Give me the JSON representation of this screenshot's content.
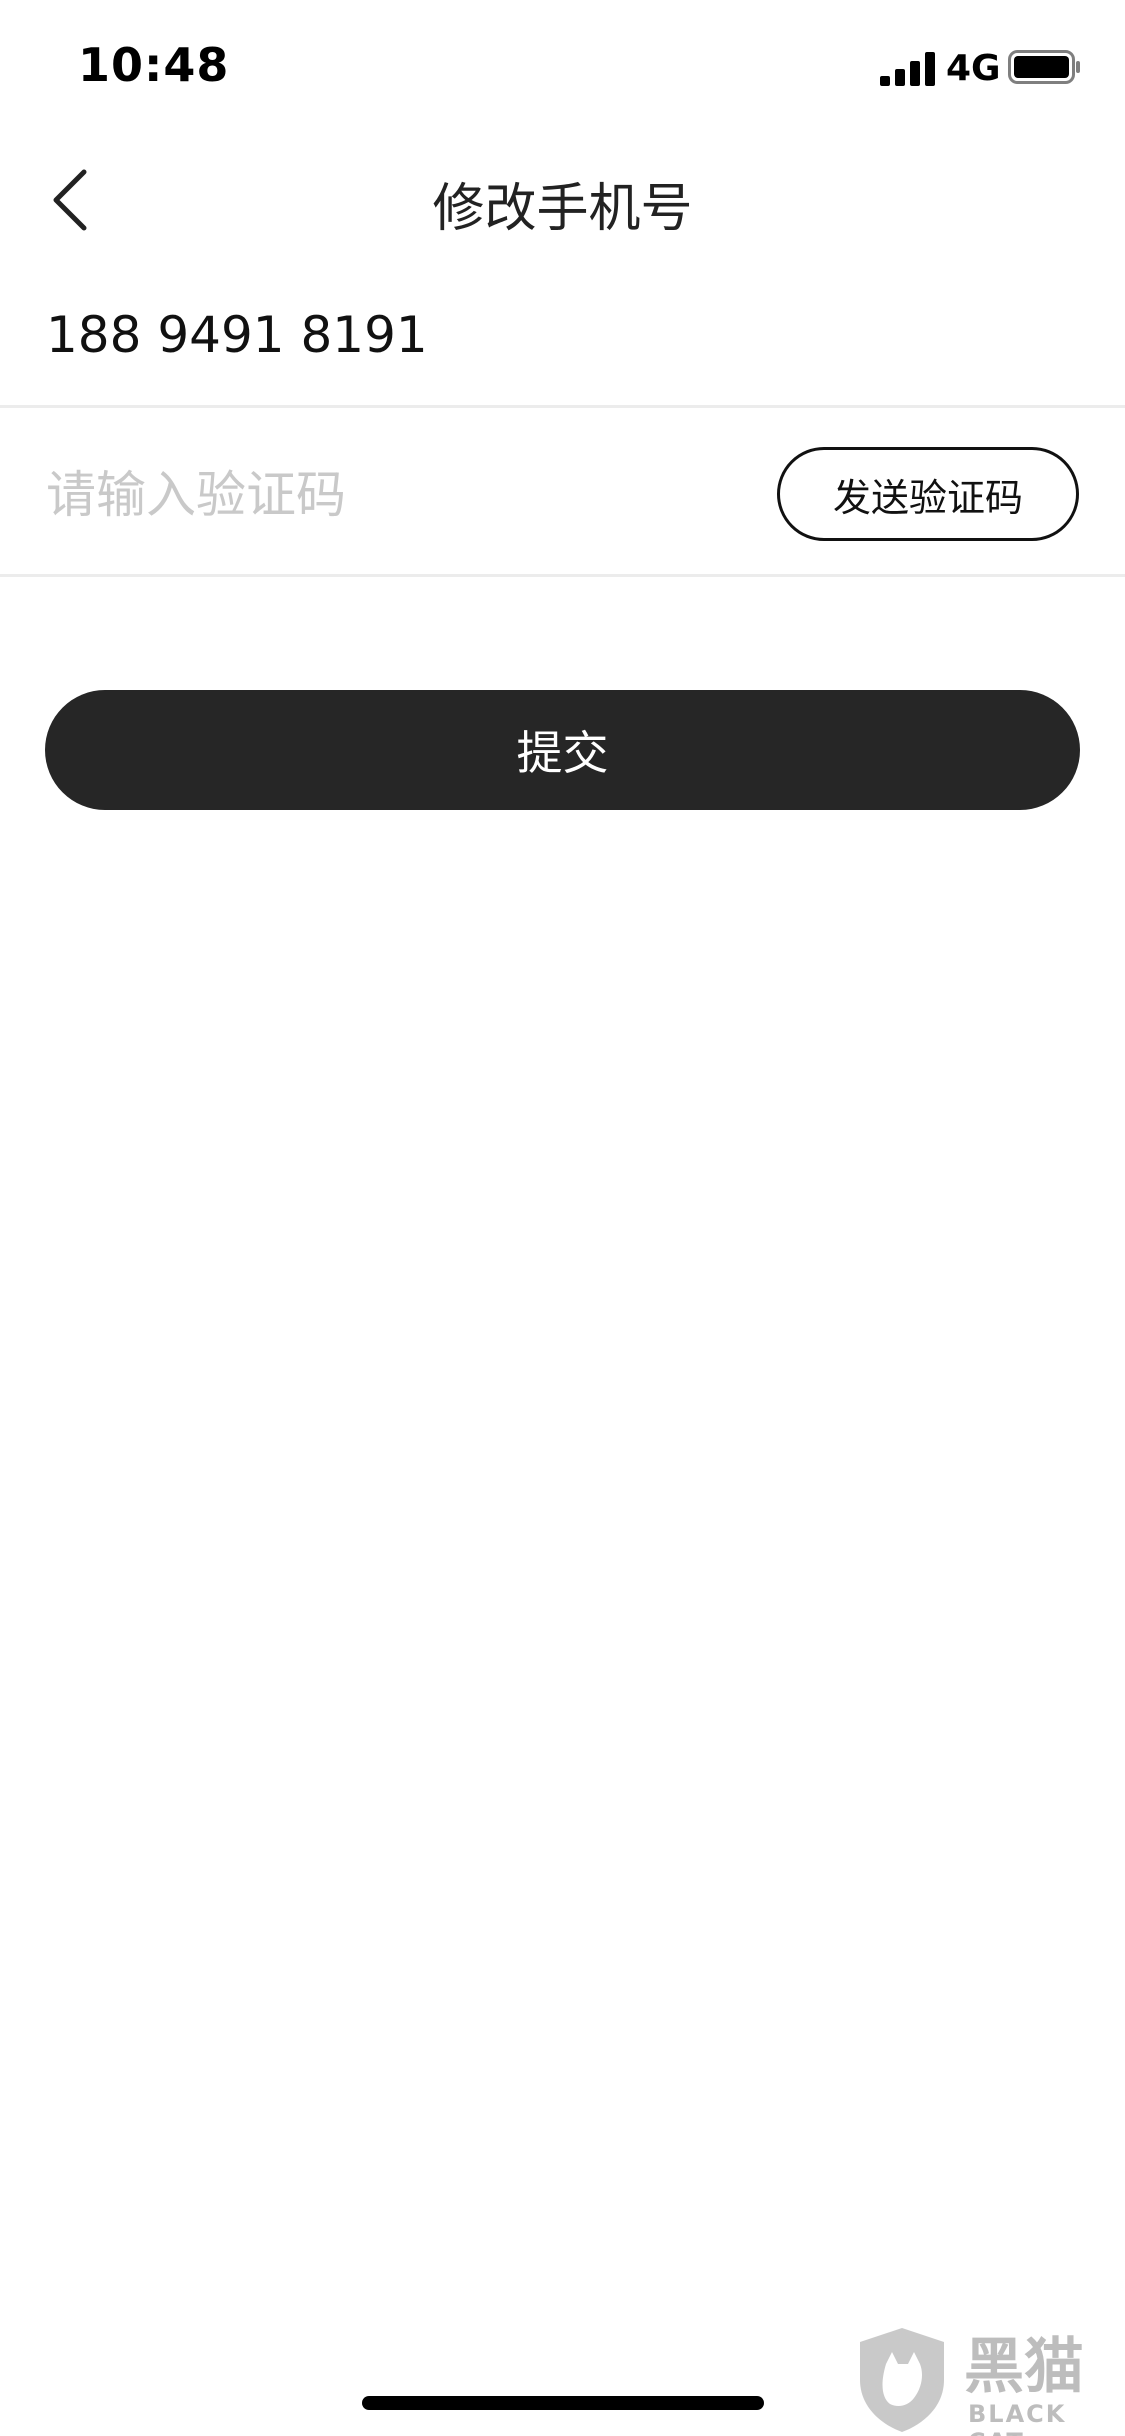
{
  "status_bar": {
    "time": "10:48",
    "network": "4G",
    "icons": [
      "signal-icon",
      "battery-icon"
    ]
  },
  "nav": {
    "title": "修改手机号",
    "back_icon": "chevron-left-icon"
  },
  "form": {
    "phone_number": "188 9491 8191",
    "code_placeholder": "请输入验证码",
    "code_value": "",
    "send_code_label": "发送验证码",
    "submit_label": "提交"
  },
  "watermark": {
    "text_cn": "黑猫",
    "text_en": "BLACK CAT"
  },
  "colors": {
    "submit_bg": "#262626",
    "divider": "#ececec",
    "placeholder": "#c9c9c9"
  }
}
